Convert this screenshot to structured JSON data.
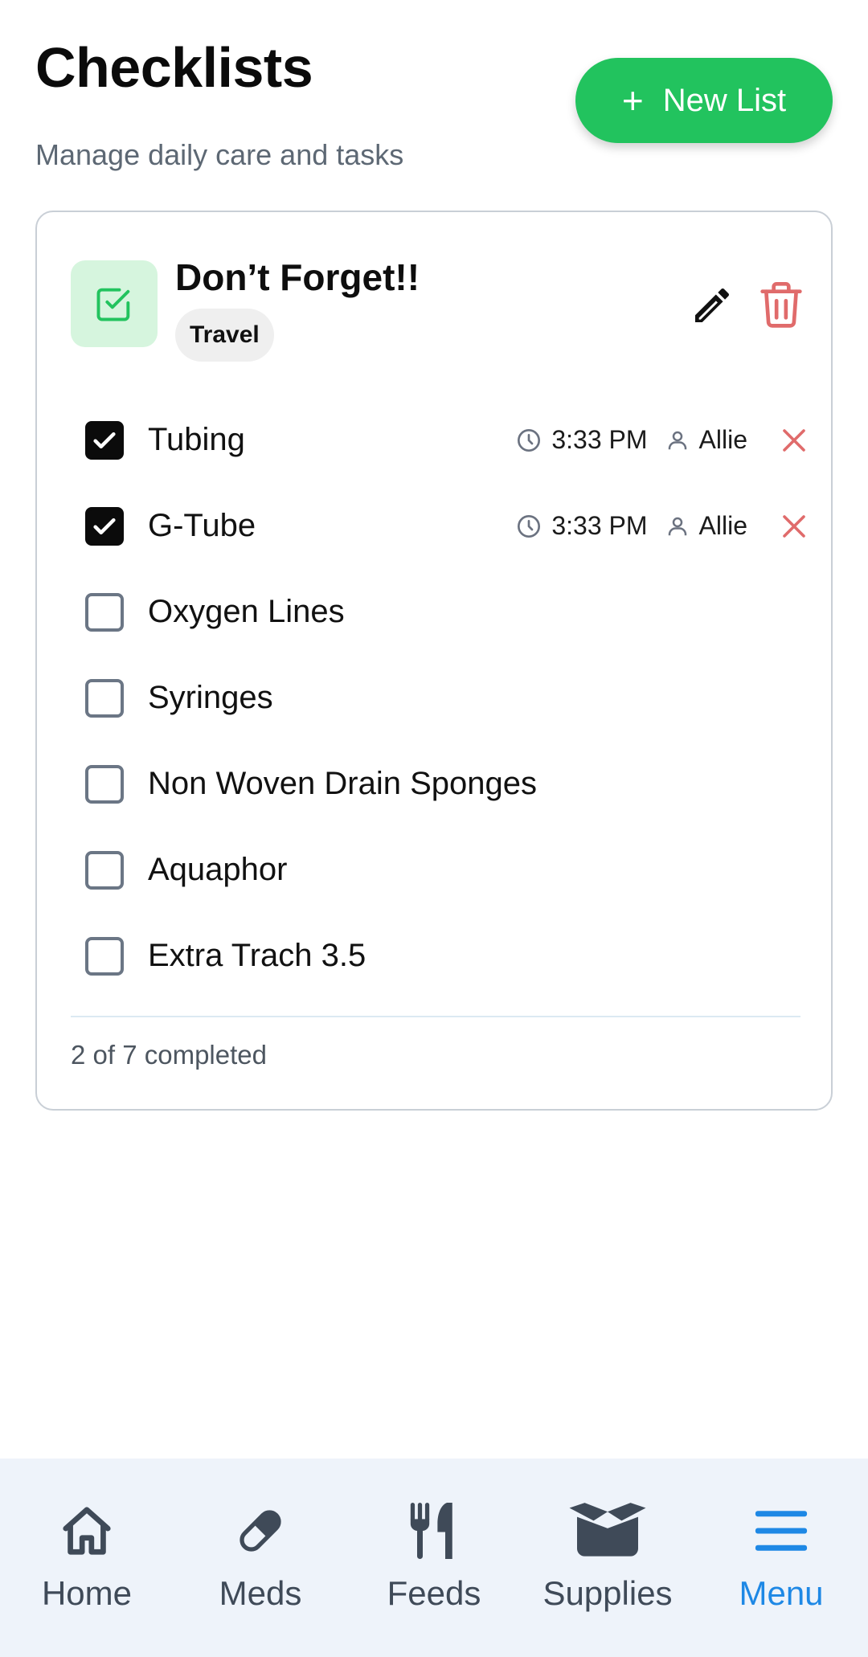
{
  "header": {
    "title": "Checklists",
    "subtitle": "Manage daily care and tasks",
    "new_list_label": "New List"
  },
  "checklist": {
    "title": "Don’t Forget!!",
    "tag": "Travel",
    "items": [
      {
        "label": "Tubing",
        "checked": true,
        "time": "3:33 PM",
        "user": "Allie"
      },
      {
        "label": "G-Tube",
        "checked": true,
        "time": "3:33 PM",
        "user": "Allie"
      },
      {
        "label": "Oxygen Lines",
        "checked": false
      },
      {
        "label": "Syringes",
        "checked": false
      },
      {
        "label": "Non Woven Drain Sponges",
        "checked": false
      },
      {
        "label": "Aquaphor",
        "checked": false
      },
      {
        "label": "Extra Trach 3.5",
        "checked": false
      }
    ],
    "progress_text": "2 of 7 completed"
  },
  "nav": {
    "items": [
      {
        "label": "Home",
        "icon": "home-icon"
      },
      {
        "label": "Meds",
        "icon": "pill-icon"
      },
      {
        "label": "Feeds",
        "icon": "utensils-icon"
      },
      {
        "label": "Supplies",
        "icon": "box-icon"
      },
      {
        "label": "Menu",
        "icon": "menu-icon",
        "active": true
      }
    ]
  },
  "colors": {
    "accent_green": "#22c35e",
    "icon_bg_green": "#d6f5de",
    "danger_red": "#e06b6b",
    "active_blue": "#1e88e5",
    "nav_bg": "#eef3fa"
  }
}
